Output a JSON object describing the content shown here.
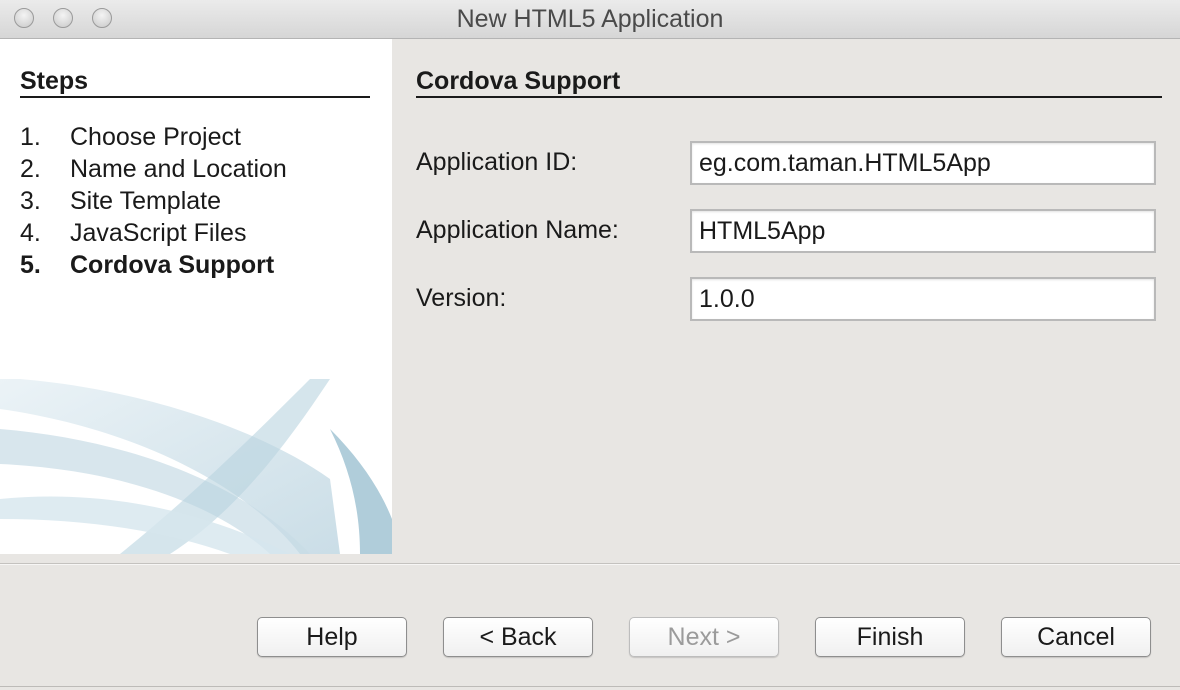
{
  "window": {
    "title": "New HTML5 Application"
  },
  "steps": {
    "heading": "Steps",
    "items": [
      {
        "num": "1.",
        "label": "Choose Project"
      },
      {
        "num": "2.",
        "label": "Name and Location"
      },
      {
        "num": "3.",
        "label": "Site Template"
      },
      {
        "num": "4.",
        "label": "JavaScript Files"
      },
      {
        "num": "5.",
        "label": "Cordova Support",
        "current": true
      }
    ]
  },
  "content": {
    "heading": "Cordova Support",
    "fields": {
      "app_id": {
        "label": "Application ID:",
        "value": "eg.com.taman.HTML5App"
      },
      "app_name": {
        "label": "Application Name:",
        "value": "HTML5App"
      },
      "version": {
        "label": "Version:",
        "value": "1.0.0"
      }
    }
  },
  "buttons": {
    "help": "Help",
    "back": "< Back",
    "next": "Next >",
    "finish": "Finish",
    "cancel": "Cancel"
  },
  "colors": {
    "window_bg": "#e8e6e3",
    "steps_bg": "#ffffff",
    "swoosh": "#a9c9d8",
    "disabled_text": "#9b9b9b"
  }
}
